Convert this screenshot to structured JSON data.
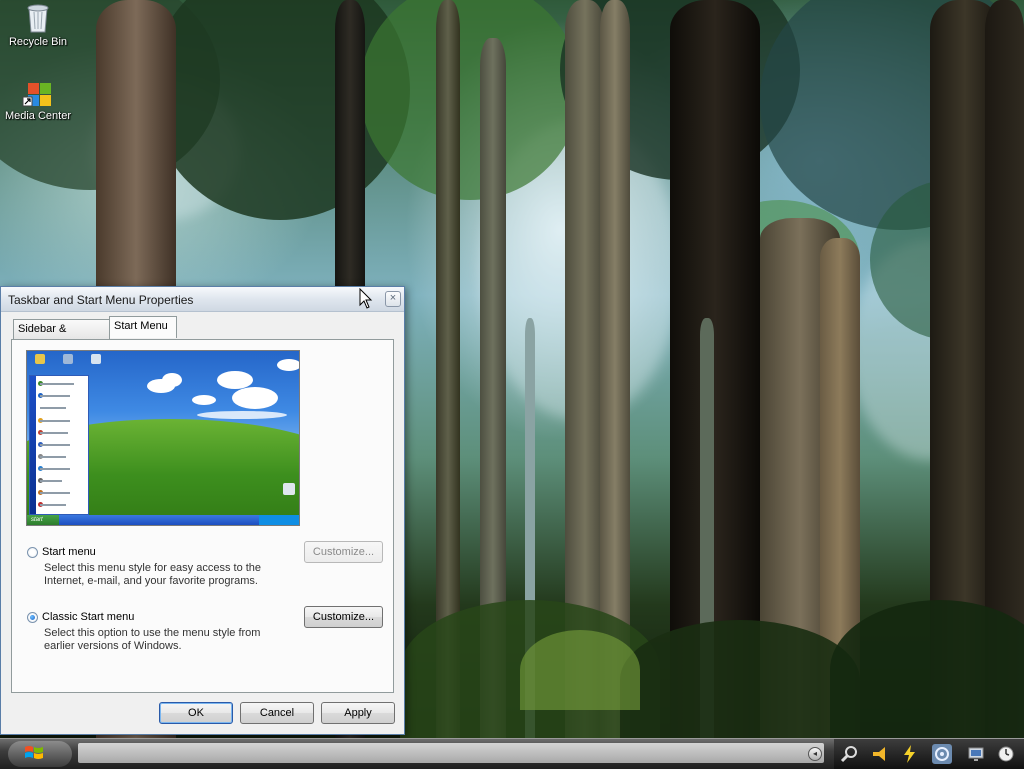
{
  "desktop": {
    "icons": [
      {
        "label": "Recycle Bin",
        "icon": "recycle-bin-icon"
      },
      {
        "label": "Media Center",
        "icon": "media-center-icon"
      }
    ]
  },
  "dialog": {
    "title": "Taskbar and Start Menu Properties",
    "close_label": "×",
    "tabs": [
      {
        "label": "Sidebar & Taskbar",
        "active": false
      },
      {
        "label": "Start Menu",
        "active": true
      }
    ],
    "preview_start_label": "start",
    "options": [
      {
        "label": "Start menu",
        "description": "Select this menu style for easy access to the Internet, e-mail, and your favorite programs.",
        "selected": false,
        "button": "Customize...",
        "button_enabled": false
      },
      {
        "label": "Classic Start menu",
        "description": "Select this option to use the menu style from earlier versions of Windows.",
        "selected": true,
        "button": "Customize...",
        "button_enabled": true
      }
    ],
    "buttons": {
      "ok": "OK",
      "cancel": "Cancel",
      "apply": "Apply"
    }
  },
  "taskbar": {
    "start_icon": "windows-flag-icon",
    "tray_expand_label": "◂",
    "tray_icons": [
      "magnifier-icon",
      "horn-icon",
      "lightning-icon",
      "network-icon",
      "monitor-icon",
      "clock-icon"
    ]
  },
  "colors": {
    "titlebar": "#dfe6ee",
    "dialog_bg": "#f0f0f0",
    "taskbar": "#3c3c3c",
    "accent": "#1d64c8"
  }
}
